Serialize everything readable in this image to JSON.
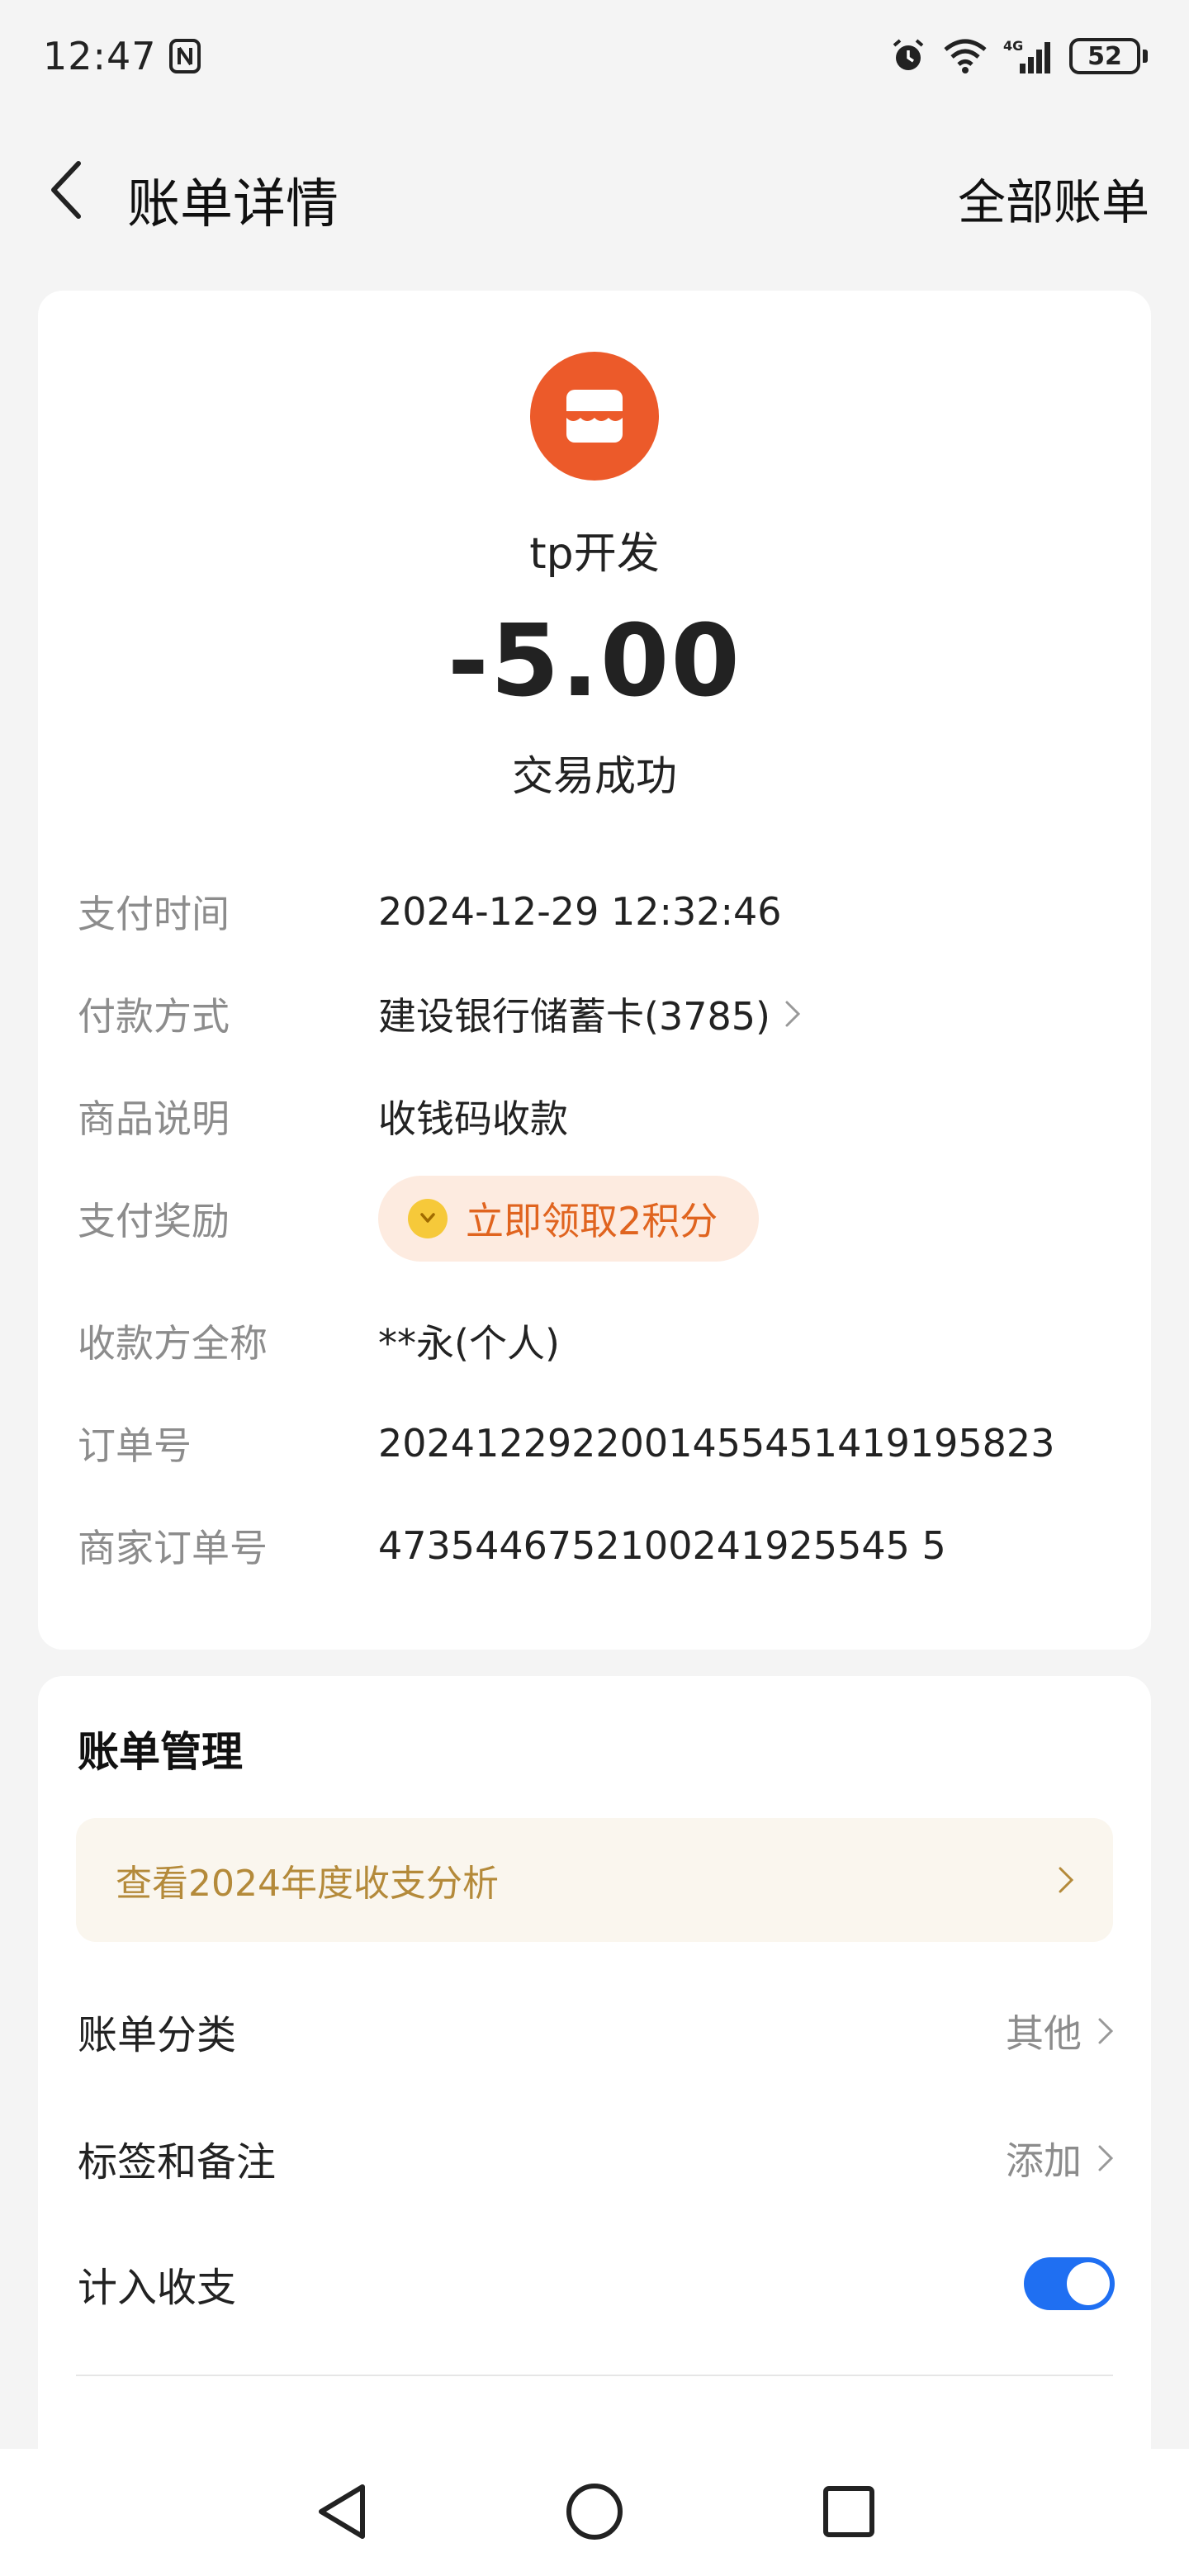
{
  "status_bar": {
    "time": "12:47",
    "network": "4G",
    "battery": "52"
  },
  "header": {
    "title": "账单详情",
    "right_action": "全部账单"
  },
  "transaction": {
    "merchant_name": "tp开发",
    "amount": "-5.00",
    "status": "交易成功",
    "merchant_logo_color": "#ec5a2a"
  },
  "details": [
    {
      "label": "支付时间",
      "value": "2024-12-29 12:32:46"
    },
    {
      "label": "付款方式",
      "value": "建设银行储蓄卡(3785)"
    },
    {
      "label": "商品说明",
      "value": "收钱码收款"
    },
    {
      "label": "支付奖励",
      "value": "立即领取2积分"
    },
    {
      "label": "收款方全称",
      "value": "**永(个人)"
    },
    {
      "label": "订单号",
      "value": "2024122922001455451419195823"
    },
    {
      "label": "商家订单号",
      "value": "4735446752100241925545 5"
    }
  ],
  "manage": {
    "title": "账单管理",
    "analysis_banner": "查看2024年度收支分析",
    "rows": [
      {
        "label": "账单分类",
        "value": "其他"
      },
      {
        "label": "标签和备注",
        "value": "添加"
      },
      {
        "label": "计入收支",
        "value": ""
      }
    ],
    "include_in_budget": true
  },
  "colors": {
    "accent": "#1f6ff2",
    "reward": "#e0641f",
    "banner_text": "#b48a3a",
    "merchant": "#ec5a2a"
  }
}
